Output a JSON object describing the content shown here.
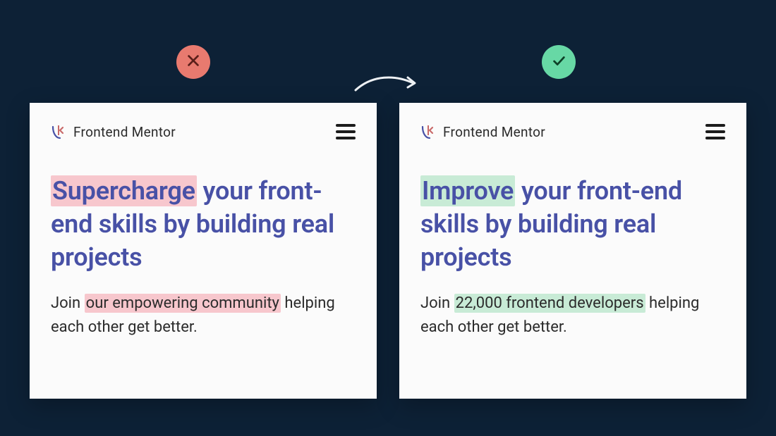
{
  "brand": {
    "name": "Frontend Mentor"
  },
  "badges": {
    "bad_icon": "x-icon",
    "good_icon": "check-icon"
  },
  "bad": {
    "headline_highlight": "Supercharge",
    "headline_rest": " your front-end skills by building real projects",
    "sub_before": "Join ",
    "sub_highlight": "our empowering community",
    "sub_after": " helping each other get better."
  },
  "good": {
    "headline_highlight": "Improve",
    "headline_rest": " your front-end skills by building real projects",
    "sub_before": "Join ",
    "sub_highlight": "22,000 frontend developers",
    "sub_after": " helping each other get better."
  },
  "colors": {
    "page_bg": "#0d2136",
    "card_bg": "#fbfbfb",
    "headline": "#4851a6",
    "body_text": "#2b2b2b",
    "badge_bad": "#e87a6f",
    "badge_good": "#67d8a5",
    "highlight_bad": "#f7c7cd",
    "highlight_good": "#c8ebd6"
  }
}
